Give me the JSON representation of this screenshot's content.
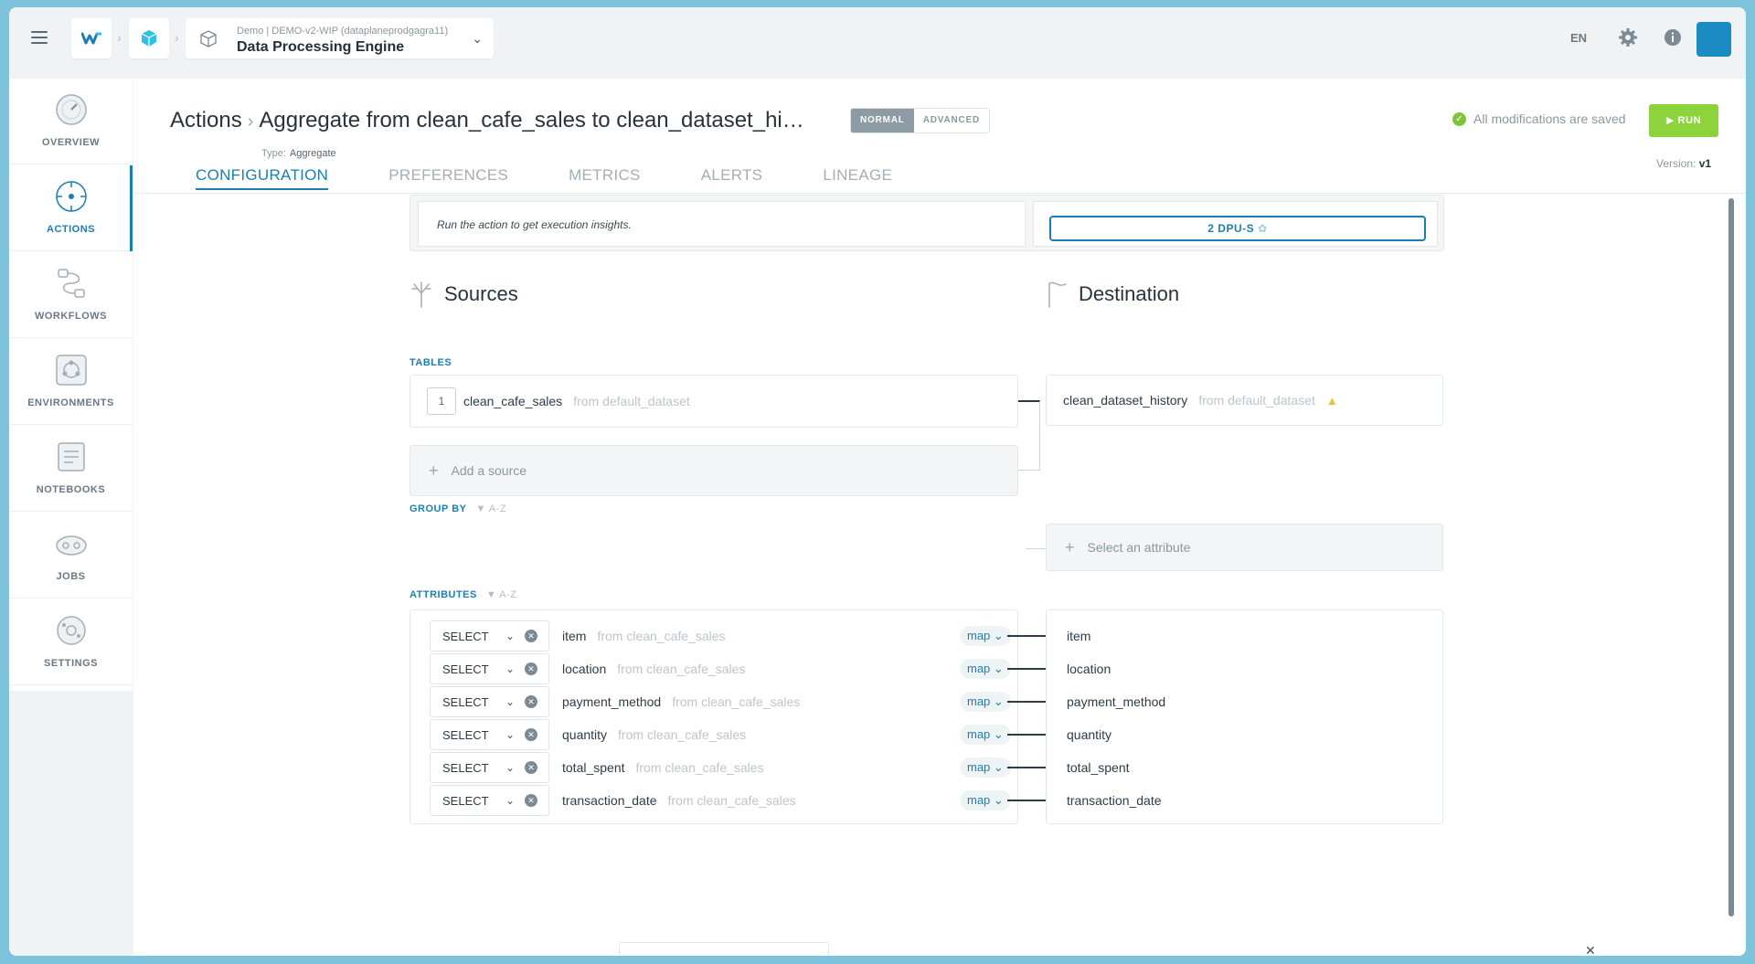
{
  "topbar": {
    "crumb_sub": "Demo  |  DEMO-v2-WIP (dataplaneprodgagra11)",
    "crumb_main": "Data Processing Engine",
    "lang": "EN"
  },
  "sidebar": {
    "items": [
      {
        "label": "OVERVIEW",
        "icon": "gauge-icon"
      },
      {
        "label": "ACTIONS",
        "icon": "target-icon"
      },
      {
        "label": "WORKFLOWS",
        "icon": "workflow-icon"
      },
      {
        "label": "ENVIRONMENTS",
        "icon": "environments-icon"
      },
      {
        "label": "NOTEBOOKS",
        "icon": "notebook-icon"
      },
      {
        "label": "JOBS",
        "icon": "jobs-icon"
      },
      {
        "label": "SETTINGS",
        "icon": "settings-icon"
      }
    ]
  },
  "header": {
    "breadcrumb_root": "Actions",
    "title": "Aggregate from clean_cafe_sales to clean_dataset_hi…",
    "type_label": "Type:",
    "type_value": "Aggregate",
    "mode_normal": "NORMAL",
    "mode_advanced": "ADVANCED",
    "saved_text": "All modifications are saved",
    "run_label": "RUN",
    "version_label": "Version:",
    "version_value": "v1",
    "tabs": [
      "CONFIGURATION",
      "PREFERENCES",
      "METRICS",
      "ALERTS",
      "LINEAGE"
    ]
  },
  "insights": {
    "text": "Run the action to get execution insights.",
    "dpu": "2 DPU-S"
  },
  "sources": {
    "heading": "Sources",
    "tables_label": "TABLES",
    "table": {
      "index": "1",
      "name": "clean_cafe_sales",
      "from": "from default_dataset"
    },
    "add_source": "Add a source"
  },
  "destination": {
    "heading": "Destination",
    "table": {
      "name": "clean_dataset_history",
      "from": "from default_dataset"
    },
    "select_attribute": "Select an attribute"
  },
  "group_by": {
    "label": "GROUP BY",
    "sort": "A-Z"
  },
  "attributes": {
    "label": "ATTRIBUTES",
    "sort": "A-Z",
    "rows": [
      {
        "op": "SELECT",
        "name": "item",
        "from": "from clean_cafe_sales",
        "map": "map",
        "dest": "item"
      },
      {
        "op": "SELECT",
        "name": "location",
        "from": "from clean_cafe_sales",
        "map": "map",
        "dest": "location"
      },
      {
        "op": "SELECT",
        "name": "payment_method",
        "from": "from clean_cafe_sales",
        "map": "map",
        "dest": "payment_method"
      },
      {
        "op": "SELECT",
        "name": "quantity",
        "from": "from clean_cafe_sales",
        "map": "map",
        "dest": "quantity"
      },
      {
        "op": "SELECT",
        "name": "total_spent",
        "from": "from clean_cafe_sales",
        "map": "map",
        "dest": "total_spent"
      },
      {
        "op": "SELECT",
        "name": "transaction_date",
        "from": "from clean_cafe_sales",
        "map": "map",
        "dest": "transaction_date"
      }
    ]
  },
  "colors": {
    "accent": "#1a7fb0",
    "run": "#8dd43c",
    "saved": "#7ec43d",
    "warning": "#e8c13a"
  }
}
